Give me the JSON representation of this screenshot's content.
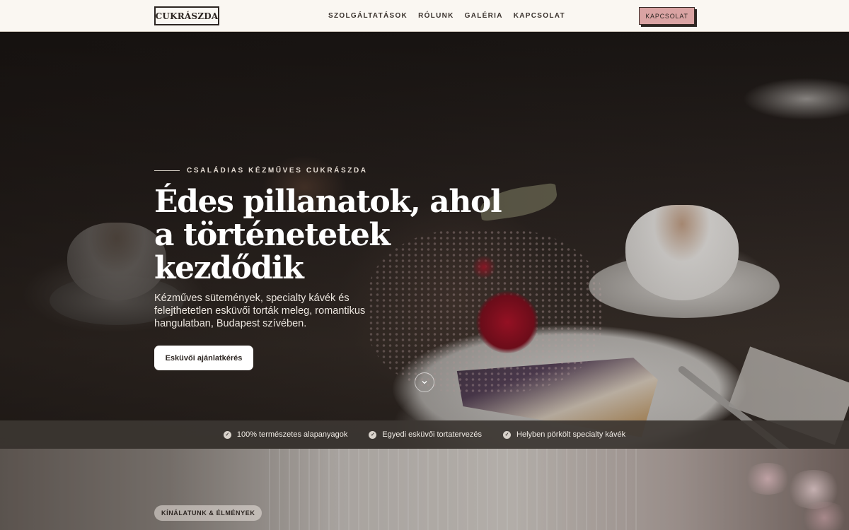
{
  "header": {
    "logo": "CUKRÁSZDA",
    "nav": [
      "SZOLGÁLTATÁSOK",
      "RÓLUNK",
      "GALÉRIA",
      "KAPCSOLAT"
    ],
    "cta_label": "KAPCSOLAT"
  },
  "hero": {
    "eyebrow": "CSALÁDIAS KÉZMŰVES CUKRÁSZDA",
    "title_lines": [
      "Édes pillanatok, ahol",
      "a történetetek",
      "kezdődik"
    ],
    "subtitle": "Kézműves sütemények, specialty kávék és felejthetetlen esküvői torták meleg, romantikus hangulatban, Budapest szívében.",
    "button_label": "Esküvői ajánlatkérés",
    "scroll_icon": "chevron-down-icon"
  },
  "features": [
    {
      "icon": "check-circle-icon",
      "label": "100% természetes alapanyagok"
    },
    {
      "icon": "check-circle-icon",
      "label": "Egyedi esküvői tortatervezés"
    },
    {
      "icon": "check-circle-icon",
      "label": "Helyben pörkölt specialty kávék"
    }
  ],
  "next_section": {
    "badge": "KÍNÁLATUNK & ÉLMÉNYEK"
  },
  "colors": {
    "header_bg": "#faf7f2",
    "cta_bg": "#d9a3a3",
    "dark_text": "#2d2622",
    "strip_bg": "#3c3632"
  }
}
